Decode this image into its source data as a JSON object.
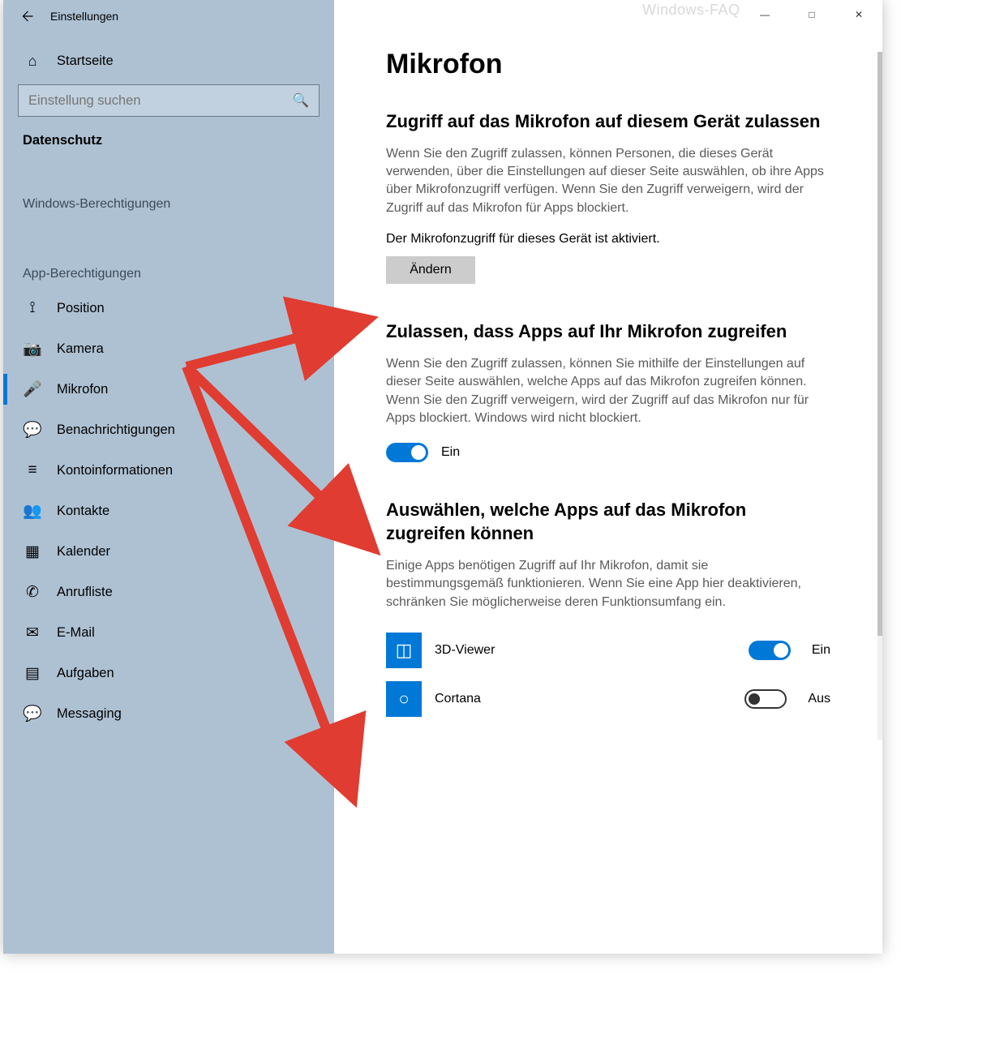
{
  "app_title": "Einstellungen",
  "watermark": "Windows-FAQ",
  "sidebar": {
    "home_label": "Startseite",
    "search_placeholder": "Einstellung suchen",
    "category": "Datenschutz",
    "group_windows": "Windows-Berechtigungen",
    "group_apps": "App-Berechtigungen",
    "items": [
      {
        "label": "Position",
        "icon": "📍"
      },
      {
        "label": "Kamera",
        "icon": "📷"
      },
      {
        "label": "Mikrofon",
        "icon": "🎤",
        "selected": true
      },
      {
        "label": "Benachrichtigungen",
        "icon": "💬"
      },
      {
        "label": "Kontoinformationen",
        "icon": "👤"
      },
      {
        "label": "Kontakte",
        "icon": "👥"
      },
      {
        "label": "Kalender",
        "icon": "📅"
      },
      {
        "label": "Anrufliste",
        "icon": "📞"
      },
      {
        "label": "E-Mail",
        "icon": "✉"
      },
      {
        "label": "Aufgaben",
        "icon": "📋"
      },
      {
        "label": "Messaging",
        "icon": "💬"
      }
    ]
  },
  "main": {
    "page_title": "Mikrofon",
    "section1": {
      "heading": "Zugriff auf das Mikrofon auf diesem Gerät zulassen",
      "para": "Wenn Sie den Zugriff zulassen, können Personen, die dieses Gerät verwenden, über die Einstellungen auf dieser Seite auswählen, ob ihre Apps über Mikrofonzugriff verfügen. Wenn Sie den Zugriff verweigern, wird der Zugriff auf das Mikrofon für Apps blockiert.",
      "status": "Der Mikrofonzugriff für dieses Gerät ist aktiviert.",
      "button": "Ändern"
    },
    "section2": {
      "heading": "Zulassen, dass Apps auf Ihr Mikrofon zugreifen",
      "para": "Wenn Sie den Zugriff zulassen, können Sie mithilfe der Einstellungen auf dieser Seite auswählen, welche Apps auf das Mikrofon zugreifen können. Wenn Sie den Zugriff verweigern, wird der Zugriff auf das Mikrofon nur für Apps blockiert. Windows wird nicht blockiert.",
      "toggle_state": "Ein"
    },
    "section3": {
      "heading": "Auswählen, welche Apps auf das Mikrofon zugreifen können",
      "para": "Einige Apps benötigen Zugriff auf Ihr Mikrofon, damit sie bestimmungsgemäß funktionieren. Wenn Sie eine App hier deaktivieren, schränken Sie möglicherweise deren Funktionsumfang ein.",
      "apps": [
        {
          "name": "3D-Viewer",
          "state": "Ein",
          "on": true,
          "icon": "◫"
        },
        {
          "name": "Cortana",
          "state": "Aus",
          "on": false,
          "icon": "○"
        }
      ]
    }
  }
}
